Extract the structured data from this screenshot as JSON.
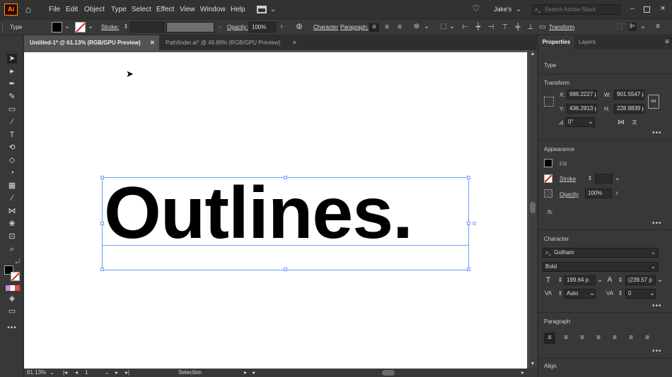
{
  "app": {
    "icon_label": "Ai"
  },
  "menu": [
    "File",
    "Edit",
    "Object",
    "Type",
    "Select",
    "Effect",
    "View",
    "Window",
    "Help"
  ],
  "user": "Jake's",
  "search": {
    "placeholder": "Search Adobe Stock"
  },
  "control": {
    "type_label": "Type",
    "stroke_label": "Stroke:",
    "opacity_label": "Opacity:",
    "opacity_value": "100%",
    "character_link": "Character",
    "paragraph_link": "Paragraph:",
    "transform_link": "Transform"
  },
  "tabs": [
    {
      "label": "Untitled-1* @ 61.13% (RGB/GPU Preview)",
      "active": true
    },
    {
      "label": "Pathfinder.ai* @ 49.89% (RGB/GPU Preview)",
      "active": false
    }
  ],
  "artboard_text": "Outlines.",
  "status": {
    "zoom": "61.13%",
    "artboard": "1",
    "mode": "Selection"
  },
  "panel": {
    "tabs": [
      "Properties",
      "Layers"
    ],
    "selection_type": "Type",
    "transform": {
      "title": "Transform",
      "x_label": "X:",
      "x": "986.2227 p",
      "y_label": "Y:",
      "y": "436.2913 p",
      "w_label": "W:",
      "w": "901.5547 p",
      "h_label": "H:",
      "h": "228.9839 p",
      "angle": "0°"
    },
    "appearance": {
      "title": "Appearance",
      "fill_label": "Fill",
      "stroke_label": "Stroke",
      "opacity_label": "Opacity",
      "opacity_value": "100%",
      "fx_label": "fx."
    },
    "character": {
      "title": "Character",
      "font": "Gotham",
      "style": "Bold",
      "size": "199.64 p",
      "leading": "(239.57 p",
      "kerning": "Auto",
      "tracking": "0"
    },
    "paragraph": {
      "title": "Paragraph"
    },
    "align": {
      "title": "Align"
    }
  },
  "colors": {
    "accent": "#6b9cff",
    "app_orange": "#ff9a00",
    "stroke_red": "#e02020"
  }
}
